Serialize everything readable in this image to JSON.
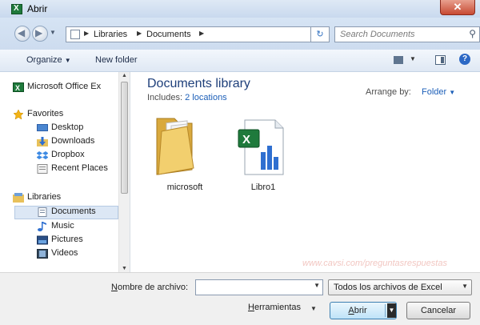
{
  "window": {
    "title": "Abrir",
    "close_glyph": "✕"
  },
  "address": {
    "crumbs": [
      "Libraries",
      "Documents"
    ],
    "search_placeholder": "Search Documents"
  },
  "toolbar": {
    "organize": "Organize",
    "new_folder": "New folder"
  },
  "nav": {
    "office": "Microsoft Office Ex",
    "favorites": "Favorites",
    "desktop": "Desktop",
    "downloads": "Downloads",
    "dropbox": "Dropbox",
    "recent": "Recent Places",
    "libraries": "Libraries",
    "documents": "Documents",
    "music": "Music",
    "pictures": "Pictures",
    "videos": "Videos"
  },
  "content": {
    "title": "Documents library",
    "includes_label": "Includes:",
    "includes_link": "2 locations",
    "arrange_label": "Arrange by:",
    "arrange_value": "Folder",
    "files": [
      "microsoft",
      "Libro1"
    ],
    "watermark": "www.cavsi.com/preguntasrespuestas"
  },
  "bottom": {
    "filename_label_u": "N",
    "filename_label_rest": "ombre de archivo:",
    "filename_value": "",
    "filetype": "Todos los archivos de Excel",
    "tools_u": "H",
    "tools_rest": "erramientas",
    "open_u": "A",
    "open_rest": "brir",
    "cancel": "Cancelar"
  },
  "colors": {
    "accent": "#1c5fb8",
    "title_blue": "#1e3f7a",
    "excel_green": "#1f7a3c"
  }
}
